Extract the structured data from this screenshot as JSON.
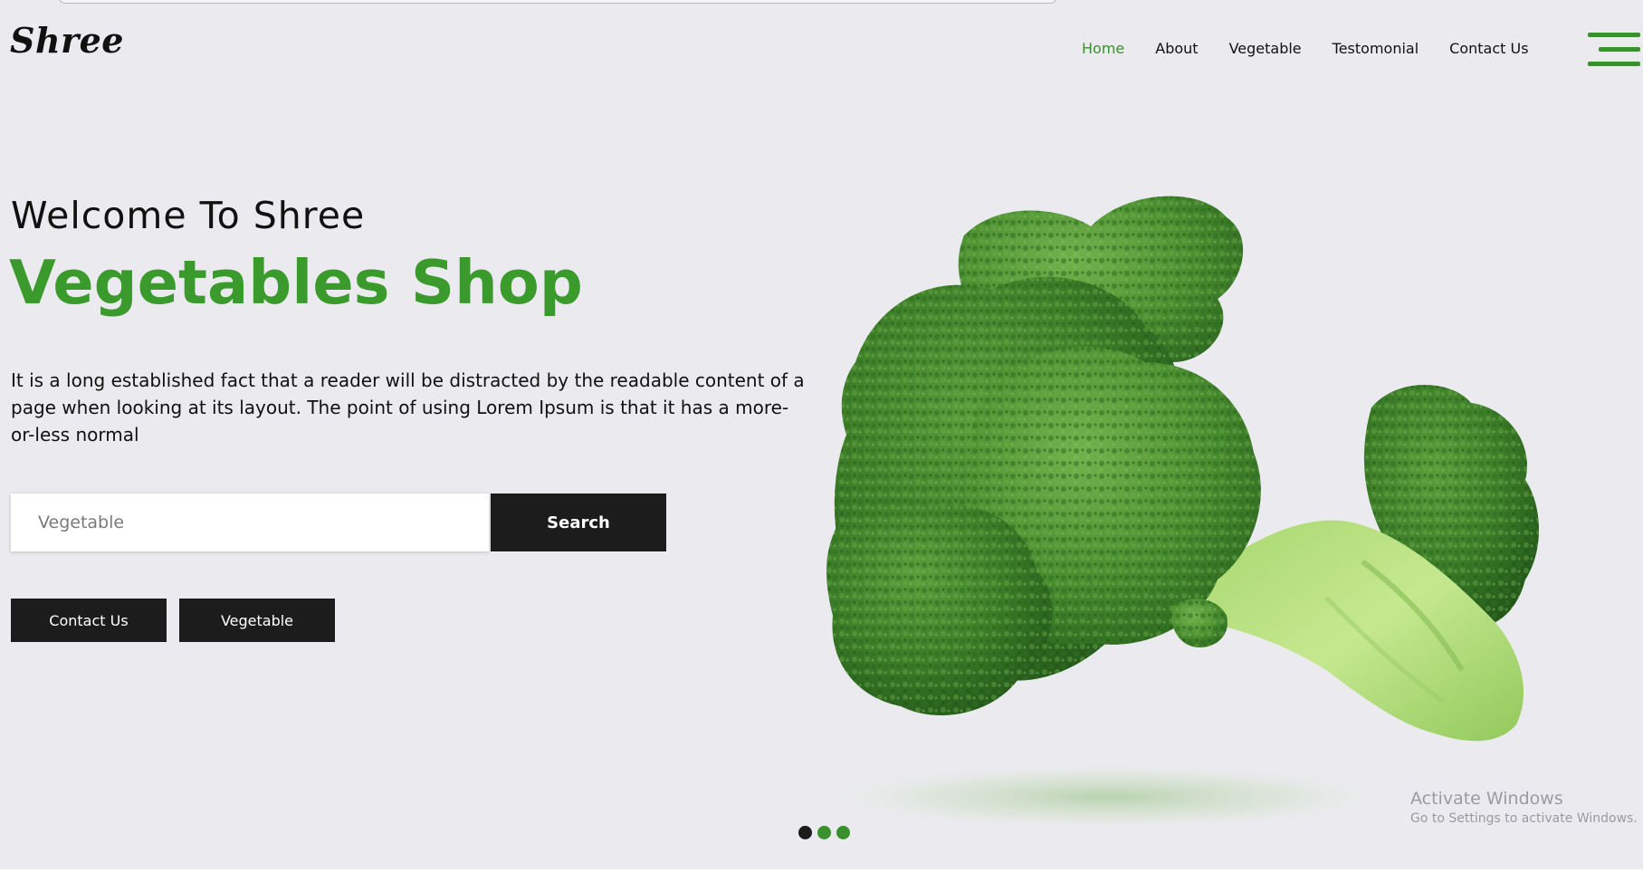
{
  "brand": {
    "logo_text": "Shree"
  },
  "nav": {
    "items": [
      {
        "label": "Home",
        "active": true
      },
      {
        "label": "About",
        "active": false
      },
      {
        "label": "Vegetable",
        "active": false
      },
      {
        "label": "Testomonial",
        "active": false
      },
      {
        "label": "Contact Us",
        "active": false
      }
    ],
    "menu_icon": "hamburger-menu-icon"
  },
  "hero": {
    "welcome": "Welcome To Shree",
    "headline": "Vegetables Shop",
    "description": "It is a long established fact that a reader will be distracted by the readable content of a page when looking at its layout. The point of using Lorem Ipsum is that it has a more-or-less normal",
    "search": {
      "placeholder": "Vegetable",
      "value": "",
      "button_label": "Search"
    },
    "buttons": {
      "contact_label": "Contact Us",
      "vegetable_label": "Vegetable"
    },
    "image": "broccoli",
    "carousel": {
      "count": 3,
      "active_index": 0
    }
  },
  "watermark": {
    "title": "Activate Windows",
    "subtitle": "Go to Settings to activate Windows."
  },
  "colors": {
    "accent": "#3a8f2e",
    "headline": "#3a9a2c",
    "dark_button": "#1c1c1c",
    "background": "#ebebef",
    "dot_active": "#1c1c1c",
    "dot_inactive": "#3a8f2e"
  }
}
